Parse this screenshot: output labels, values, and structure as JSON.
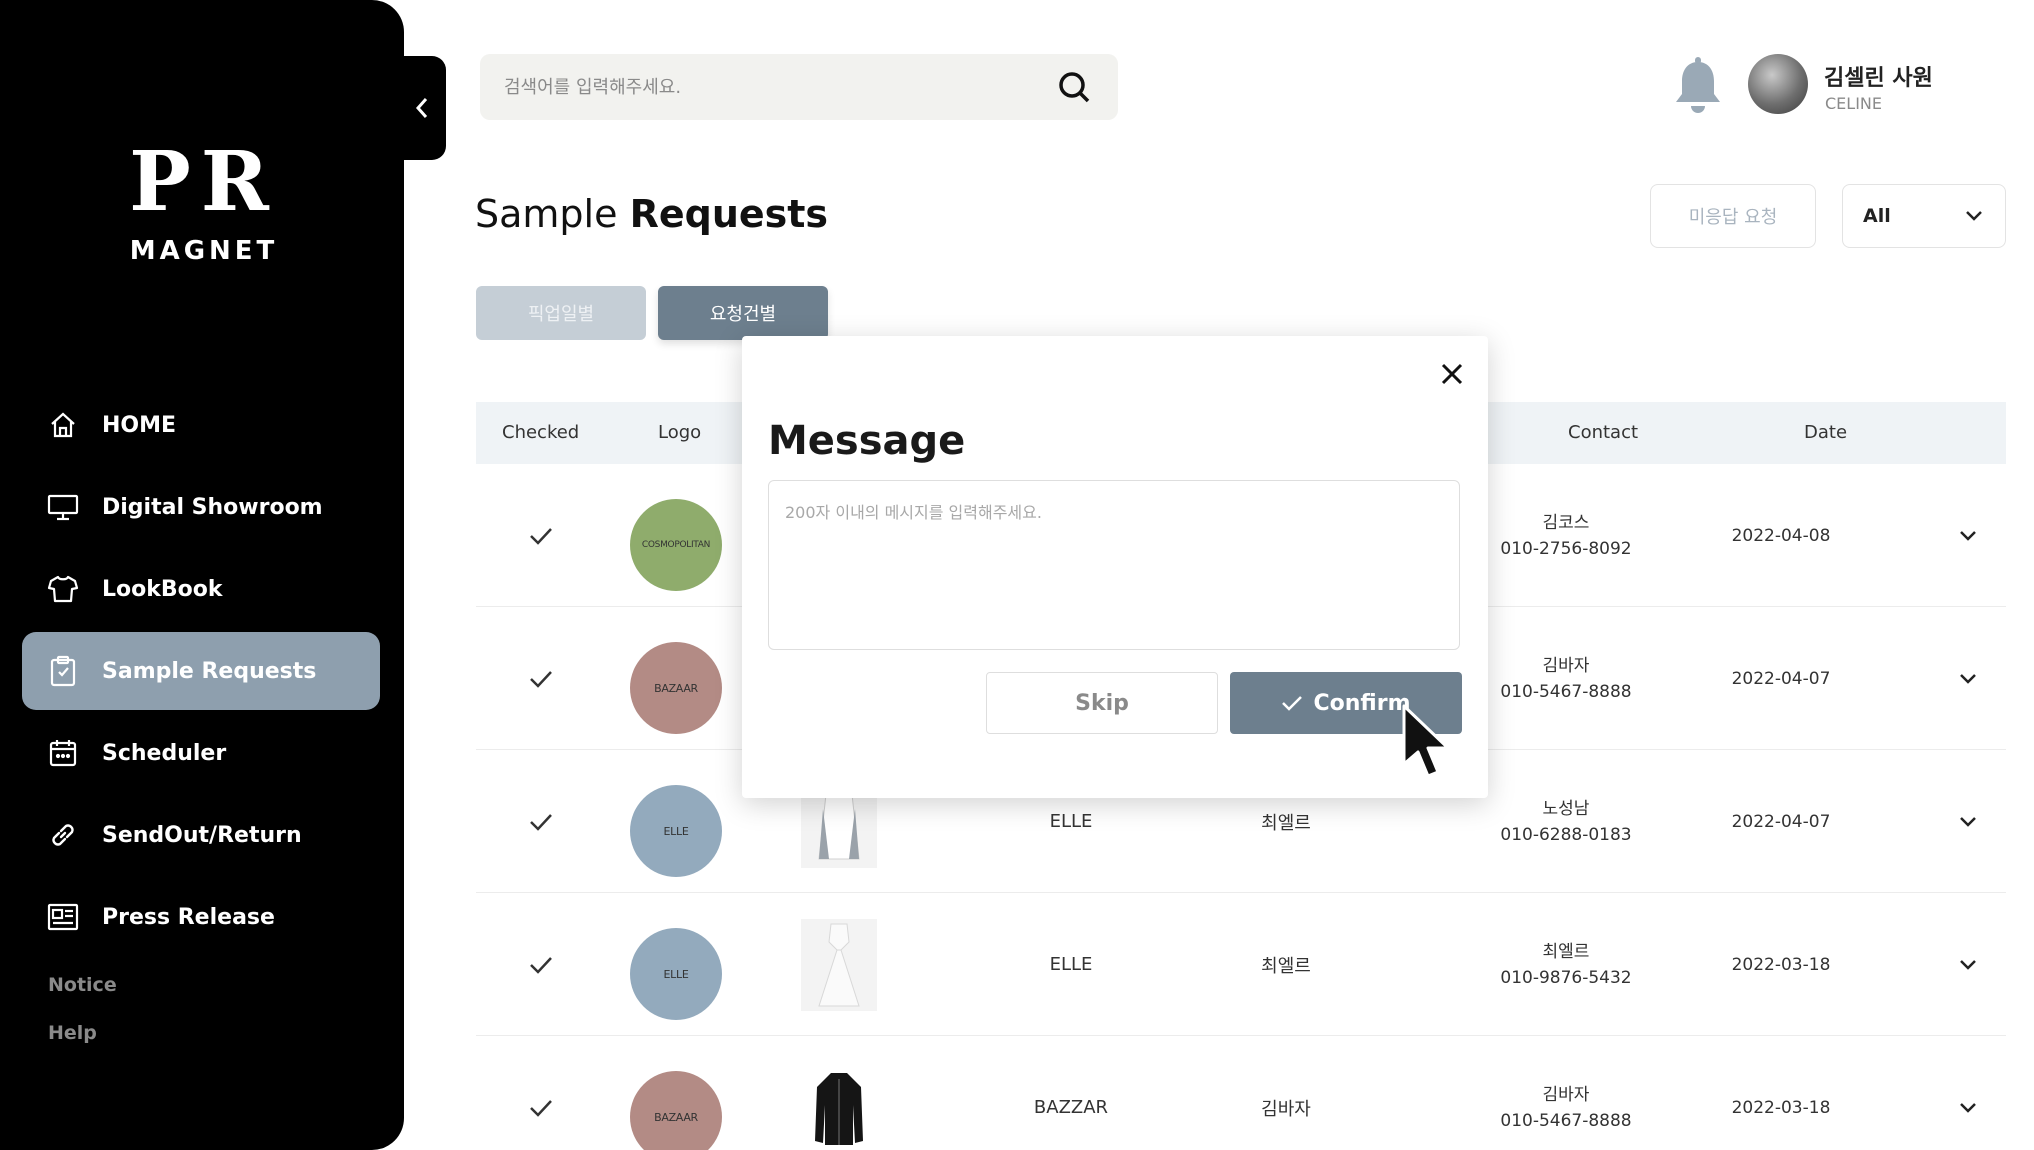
{
  "sidebar": {
    "logo_top": "PR",
    "logo_bottom": "MAGNET",
    "items": [
      {
        "label": "HOME",
        "icon": "home-icon"
      },
      {
        "label": "Digital Showroom",
        "icon": "monitor-icon"
      },
      {
        "label": "LookBook",
        "icon": "shirt-icon"
      },
      {
        "label": "Sample Requests",
        "icon": "clipboard-icon",
        "active": true
      },
      {
        "label": "Scheduler",
        "icon": "calendar-icon"
      },
      {
        "label": "SendOut/Return",
        "icon": "link-icon"
      },
      {
        "label": "Press Release",
        "icon": "newspaper-icon"
      }
    ],
    "links": [
      "Notice",
      "Help"
    ]
  },
  "search": {
    "placeholder": "검색어를 입력해주세요."
  },
  "user": {
    "name": "김셀린 사원",
    "company": "CELINE"
  },
  "page": {
    "title_light": "Sample",
    "title_bold": "Requests",
    "unanswered_button": "미응답 요청",
    "filter_value": "All",
    "tabs": [
      "픽업일별",
      "요청건별"
    ]
  },
  "table": {
    "headers": {
      "checked": "Checked",
      "logo": "Logo",
      "contact": "Contact",
      "date": "Date"
    },
    "rows": [
      {
        "logo": "COSMOPOLITAN",
        "logo_color": "#8fac6c",
        "magazine": "",
        "editor": "",
        "contact_name": "김코스",
        "contact_phone": "010-2756-8092",
        "date": "2022-04-08"
      },
      {
        "logo": "BAZAAR",
        "logo_color": "#b38b85",
        "magazine": "",
        "editor": "",
        "contact_name": "김바자",
        "contact_phone": "010-5467-8888",
        "date": "2022-04-07"
      },
      {
        "logo": "ELLE",
        "logo_color": "#93aabd",
        "magazine": "ELLE",
        "editor": "최엘르",
        "contact_name": "노성남",
        "contact_phone": "010-6288-0183",
        "date": "2022-04-07"
      },
      {
        "logo": "ELLE",
        "logo_color": "#93aabd",
        "magazine": "ELLE",
        "editor": "최엘르",
        "contact_name": "최엘르",
        "contact_phone": "010-9876-5432",
        "date": "2022-03-18"
      },
      {
        "logo": "BAZAAR",
        "logo_color": "#b38b85",
        "magazine": "BAZZAR",
        "editor": "김바자",
        "contact_name": "김바자",
        "contact_phone": "010-5467-8888",
        "date": "2022-03-18"
      }
    ]
  },
  "modal": {
    "title": "Message",
    "placeholder": "200자 이내의 메시지를 입력해주세요.",
    "skip_label": "Skip",
    "confirm_label": "Confirm"
  },
  "colors": {
    "accent": "#8e9fae",
    "button": "#6d7f8e",
    "header_bg": "#eff3f6"
  }
}
